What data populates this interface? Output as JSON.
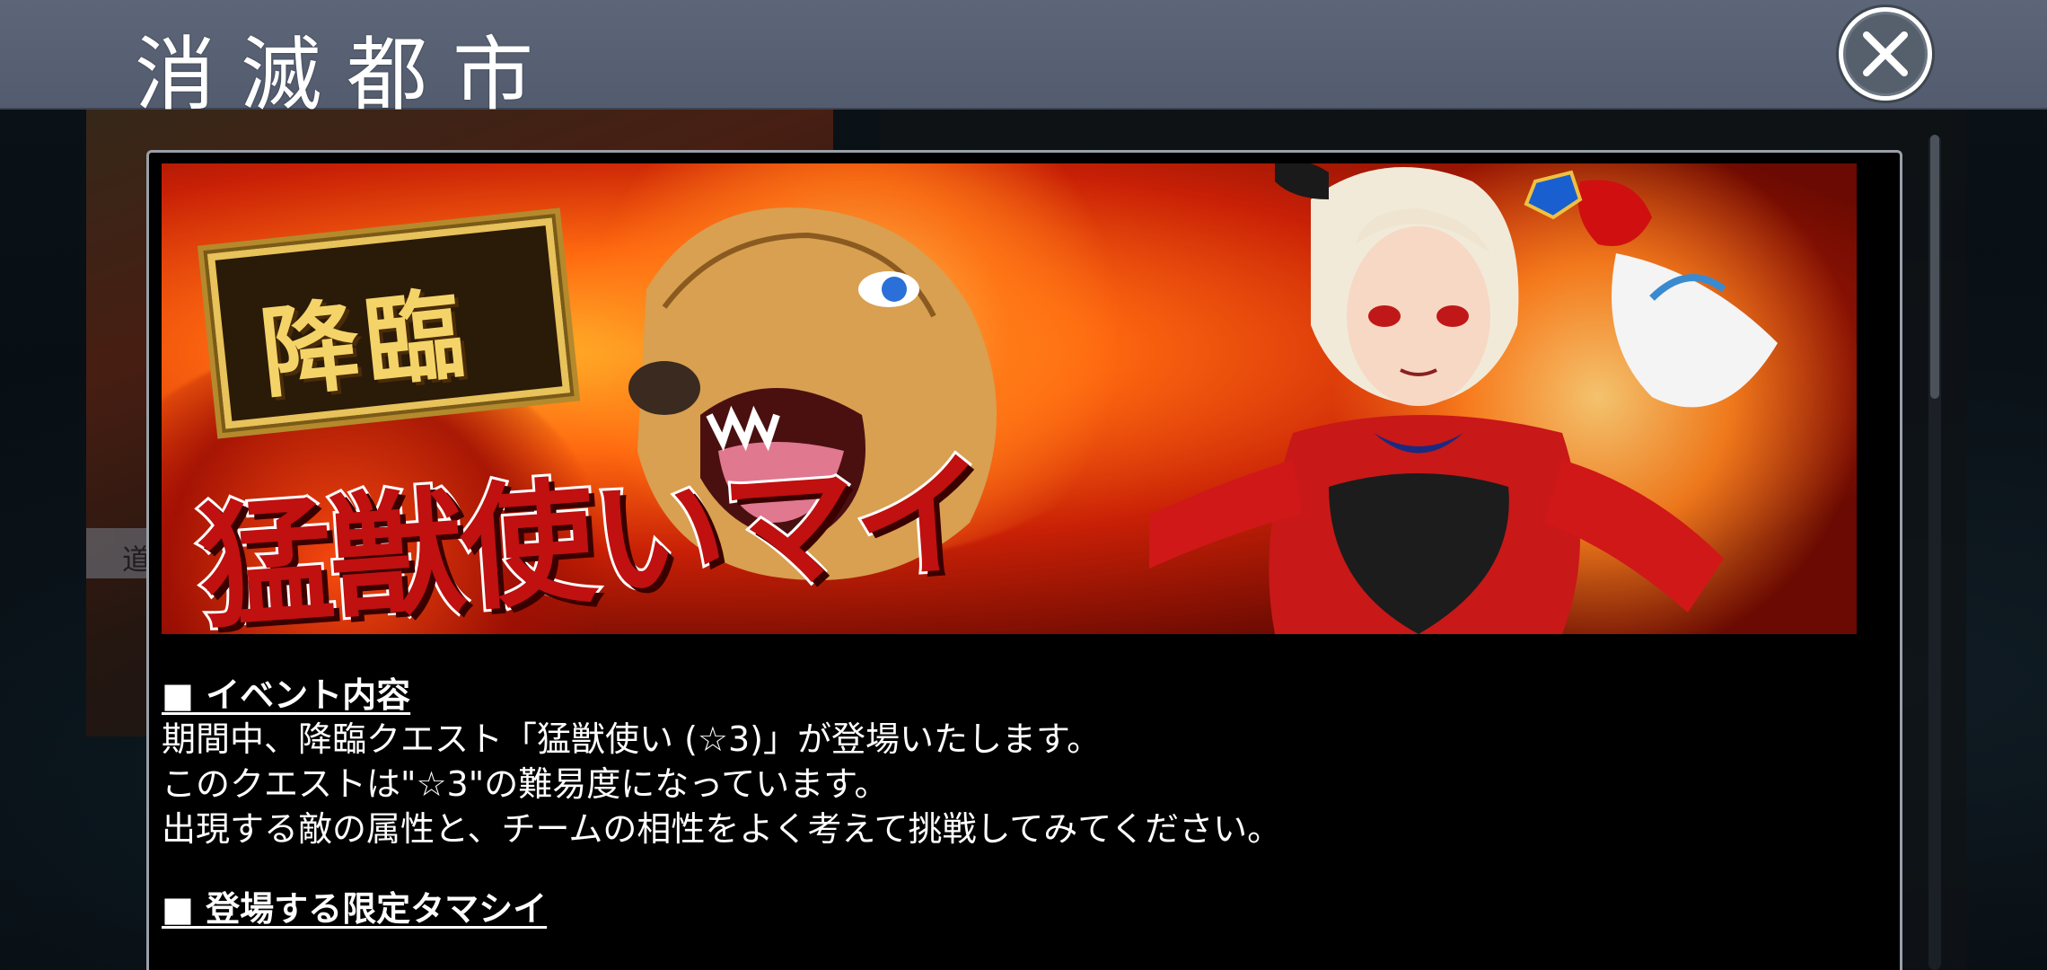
{
  "header": {
    "title": "消滅都市"
  },
  "background": {
    "strip_text": "道"
  },
  "banner": {
    "badge_text": "降臨",
    "event_name": "猛獣使いマイ"
  },
  "content": {
    "section1_heading": "■ イベント内容",
    "section1_lines": [
      "期間中、降臨クエスト「猛獣使い (☆3)」が登場いたします。",
      "このクエストは\"☆3\"の難易度になっています。",
      "出現する敵の属性と、チームの相性をよく考えて挑戦してみてください。"
    ],
    "section2_heading": "■ 登場する限定タマシイ"
  },
  "colors": {
    "title_bar": "#5d6678",
    "modal_bg": "#000000",
    "text": "#ffffff"
  },
  "icons": {
    "close": "close-icon"
  }
}
